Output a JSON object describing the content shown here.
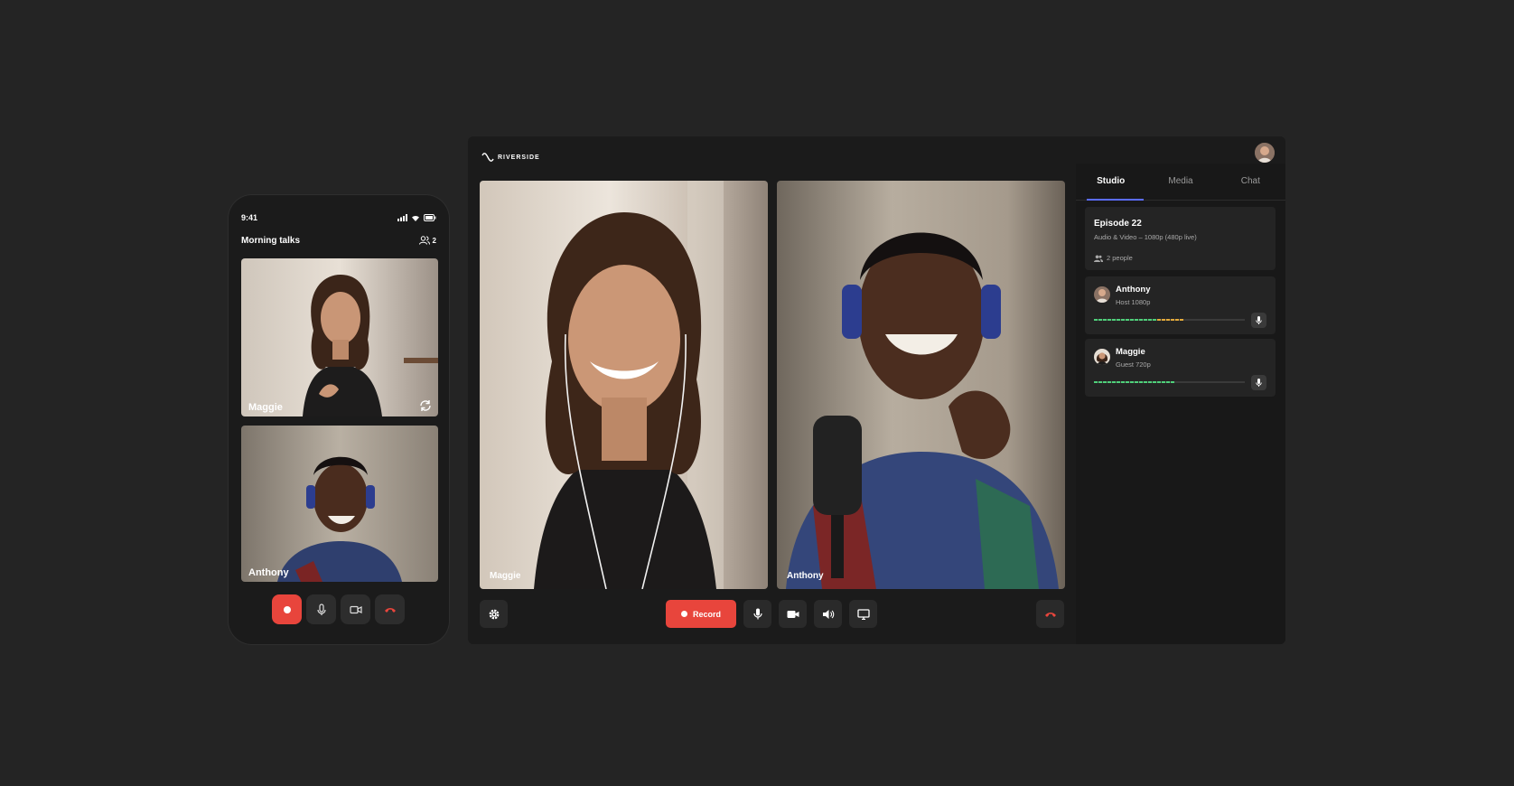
{
  "phone": {
    "time": "9:41",
    "room_title": "Morning talks",
    "participant_count": "2",
    "tiles": [
      {
        "name": "Maggie"
      },
      {
        "name": "Anthony"
      }
    ]
  },
  "app": {
    "brand": "RIVERSIDE",
    "tiles": [
      {
        "name": "Maggie"
      },
      {
        "name": "Anthony"
      }
    ],
    "toolbar": {
      "record_label": "Record"
    },
    "panel": {
      "tabs": [
        "Studio",
        "Media",
        "Chat"
      ],
      "active_tab": "Studio",
      "episode": {
        "title": "Episode 22",
        "subtitle": "Audio & Video – 1080p (480p live)",
        "people": "2 people"
      },
      "participants": [
        {
          "name": "Anthony",
          "role": "Host  1080p",
          "audio_level": 0.6
        },
        {
          "name": "Maggie",
          "role": "Guest  720p",
          "audio_level": 0.54
        }
      ]
    }
  },
  "colors": {
    "background": "#242424",
    "record": "#e8453c",
    "accent_tab": "#5b6cff",
    "level_green": "#4ed07a",
    "level_amber": "#e2a93a"
  },
  "icons": [
    "riverside-logo-icon",
    "signal-icon",
    "wifi-icon",
    "battery-icon",
    "people-icon",
    "camera-switch-icon",
    "record-icon",
    "mic-icon",
    "video-icon",
    "hangup-icon",
    "settings-icon",
    "speaker-icon",
    "screen-share-icon"
  ]
}
